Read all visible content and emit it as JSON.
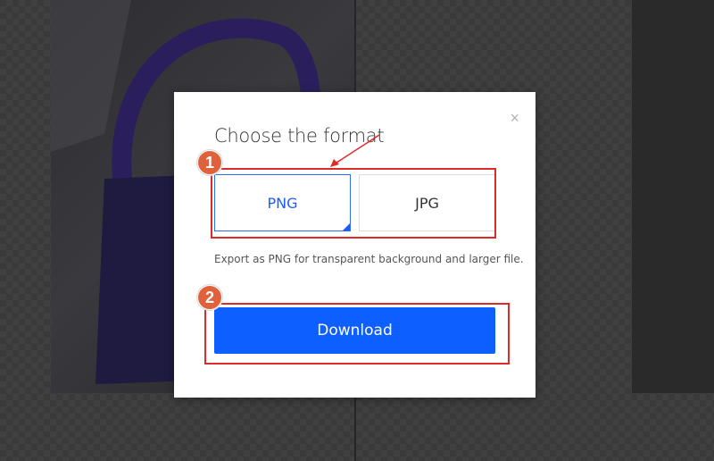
{
  "modal": {
    "title": "Choose the format",
    "close_symbol": "×",
    "formats": [
      {
        "label": "PNG",
        "selected": true
      },
      {
        "label": "JPG",
        "selected": false
      }
    ],
    "hint": "Export as PNG for transparent background and larger file.",
    "download_label": "Download"
  },
  "annotations": {
    "step1": "1",
    "step2": "2",
    "color": "#e02a2a",
    "badge_color": "#e0623c"
  },
  "colors": {
    "accent": "#0d5fff",
    "selected_text": "#1a5cff"
  },
  "icons": [
    "close-icon",
    "selected-check-corner-icon",
    "annotation-arrow-icon"
  ]
}
